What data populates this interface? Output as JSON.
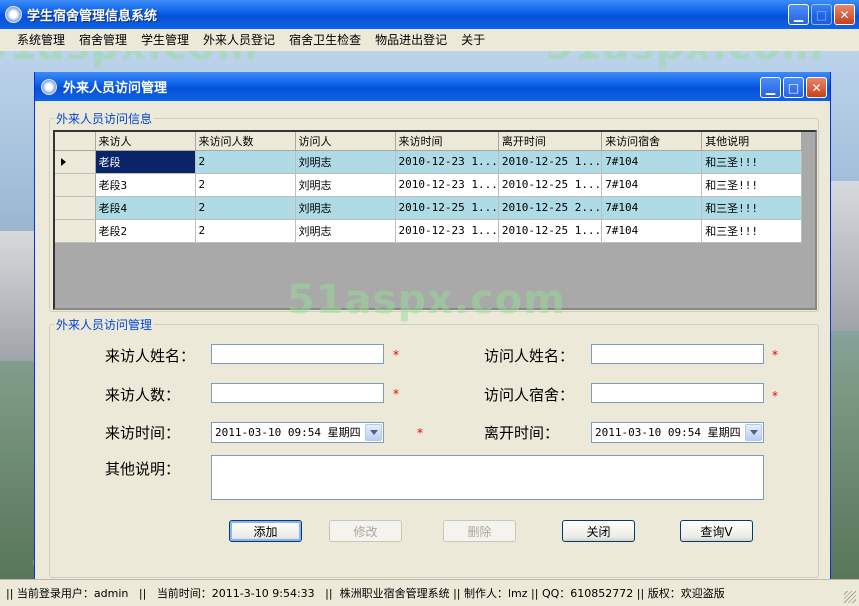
{
  "app": {
    "title": "学生宿舍管理信息系统"
  },
  "menu": [
    "系统管理",
    "宿舍管理",
    "学生管理",
    "外来人员登记",
    "宿舍卫生检查",
    "物品进出登记",
    "关于"
  ],
  "watermark": "51aspx.com",
  "window": {
    "title": "外来人员访问管理"
  },
  "grid": {
    "legend": "外来人员访问信息",
    "columns": [
      "来访人",
      "来访问人数",
      "访问人",
      "来访时间",
      "离开时间",
      "来访问宿舍",
      "其他说明"
    ],
    "rows": [
      [
        "老段",
        "2",
        "刘明志",
        "2010-12-23 1...",
        "2010-12-25 1...",
        "7#104",
        "和三圣!!!"
      ],
      [
        "老段3",
        "2",
        "刘明志",
        "2010-12-23 1...",
        "2010-12-25 1...",
        "7#104",
        "和三圣!!!"
      ],
      [
        "老段4",
        "2",
        "刘明志",
        "2010-12-25 1...",
        "2010-12-25 2...",
        "7#104",
        "和三圣!!!"
      ],
      [
        "老段2",
        "2",
        "刘明志",
        "2010-12-23 1...",
        "2010-12-25 1...",
        "7#104",
        "和三圣!!!"
      ]
    ]
  },
  "form": {
    "legend": "外来人员访问管理",
    "visitor_name_label": "来访人姓名：",
    "host_name_label": "访问人姓名：",
    "visitor_count_label": "来访人数：",
    "host_dorm_label": "访问人宿舍：",
    "visit_time_label": "来访时间：",
    "leave_time_label": "离开时间：",
    "notes_label": "其他说明：",
    "visit_time_value": "2011-03-10 09:54 星期四",
    "leave_time_value": "2011-03-10 09:54 星期四",
    "required_mark": "*"
  },
  "buttons": {
    "add": "添加",
    "edit": "修改",
    "delete": "删除",
    "close": "关闭",
    "query": "查询V"
  },
  "status": {
    "user": "当前登录用户：admin",
    "sep": "||",
    "time": "当前时间：2011-3-10 9:54:33",
    "system": "株洲职业宿舍管理系统",
    "author": "制作人：lmz",
    "qq": "QQ：610852772",
    "copyright": "版权：欢迎盗版"
  },
  "colors": {
    "titlebar": "#0a5ee8",
    "grid_alt_row": "#aedbe5",
    "required": "#ee0000",
    "legend": "#0046d5"
  }
}
